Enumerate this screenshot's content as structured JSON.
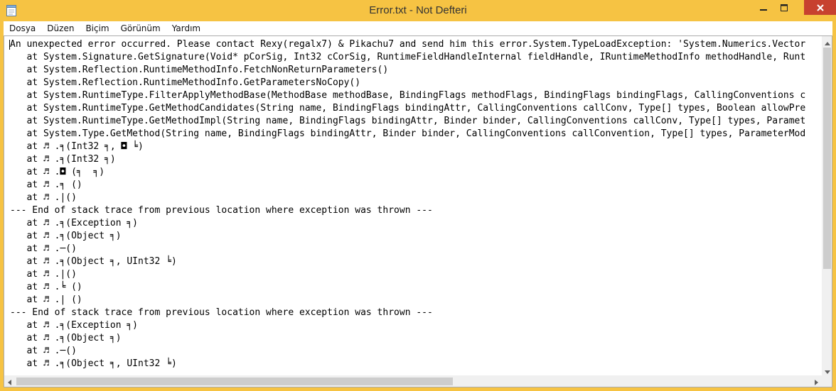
{
  "window": {
    "title": "Error.txt - Not Defteri"
  },
  "icons": {
    "app": "notepad-icon",
    "minimize": "minimize-icon",
    "maximize": "maximize-icon",
    "close": "close-icon",
    "scroll_up": "chevron-up-icon",
    "scroll_down": "chevron-down-icon",
    "scroll_left": "chevron-left-icon",
    "scroll_right": "chevron-right-icon"
  },
  "colors": {
    "titlebar": "#f6c343",
    "close_button": "#c7412f",
    "editor_background": "#ffffff"
  },
  "menu": {
    "items": [
      {
        "label": "Dosya"
      },
      {
        "label": "Düzen"
      },
      {
        "label": "Biçim"
      },
      {
        "label": "Görünüm"
      },
      {
        "label": "Yardım"
      }
    ]
  },
  "document": {
    "lines": [
      "An unexpected error occurred. Please contact Rexy(regalx7) & Pikachu7 and send him this error.System.TypeLoadException: 'System.Numerics.Vector",
      "   at System.Signature.GetSignature(Void* pCorSig, Int32 cCorSig, RuntimeFieldHandleInternal fieldHandle, IRuntimeMethodInfo methodHandle, Runt",
      "   at System.Reflection.RuntimeMethodInfo.FetchNonReturnParameters()",
      "   at System.Reflection.RuntimeMethodInfo.GetParametersNoCopy()",
      "   at System.RuntimeType.FilterApplyMethodBase(MethodBase methodBase, BindingFlags methodFlags, BindingFlags bindingFlags, CallingConventions c",
      "   at System.RuntimeType.GetMethodCandidates(String name, BindingFlags bindingAttr, CallingConventions callConv, Type[] types, Boolean allowPre",
      "   at System.RuntimeType.GetMethodImpl(String name, BindingFlags bindingAttr, Binder binder, CallingConventions callConv, Type[] types, Paramet",
      "   at System.Type.GetMethod(String name, BindingFlags bindingAttr, Binder binder, CallingConventions callConvention, Type[] types, ParameterMod",
      "   at ♬ .╕(Int32 ╕, ◘ ╘)",
      "   at ♬ .╕(Int32 ╕)",
      "   at ♬ .◘ (╕  ╕)",
      "   at ♬ .╕ ()",
      "   at ♬ .|()",
      "--- End of stack trace from previous location where exception was thrown ---",
      "   at ♬ .╕(Exception ╕)",
      "   at ♬ .╕(Object ╕)",
      "   at ♬ .─()",
      "   at ♬ .╕(Object ╕, UInt32 ╘)",
      "   at ♬ .|()",
      "   at ♬ .╘ ()",
      "   at ♬ .| ()",
      "--- End of stack trace from previous location where exception was thrown ---",
      "   at ♬ .╕(Exception ╕)",
      "   at ♬ .╕(Object ╕)",
      "   at ♬ .─()",
      "   at ♬ .╕(Object ╕, UInt32 ╘)"
    ]
  },
  "scroll": {
    "vertical_position": 0.0,
    "vertical_visible_fraction": 0.7,
    "horizontal_position": 0.0,
    "horizontal_visible_fraction": 0.55
  }
}
